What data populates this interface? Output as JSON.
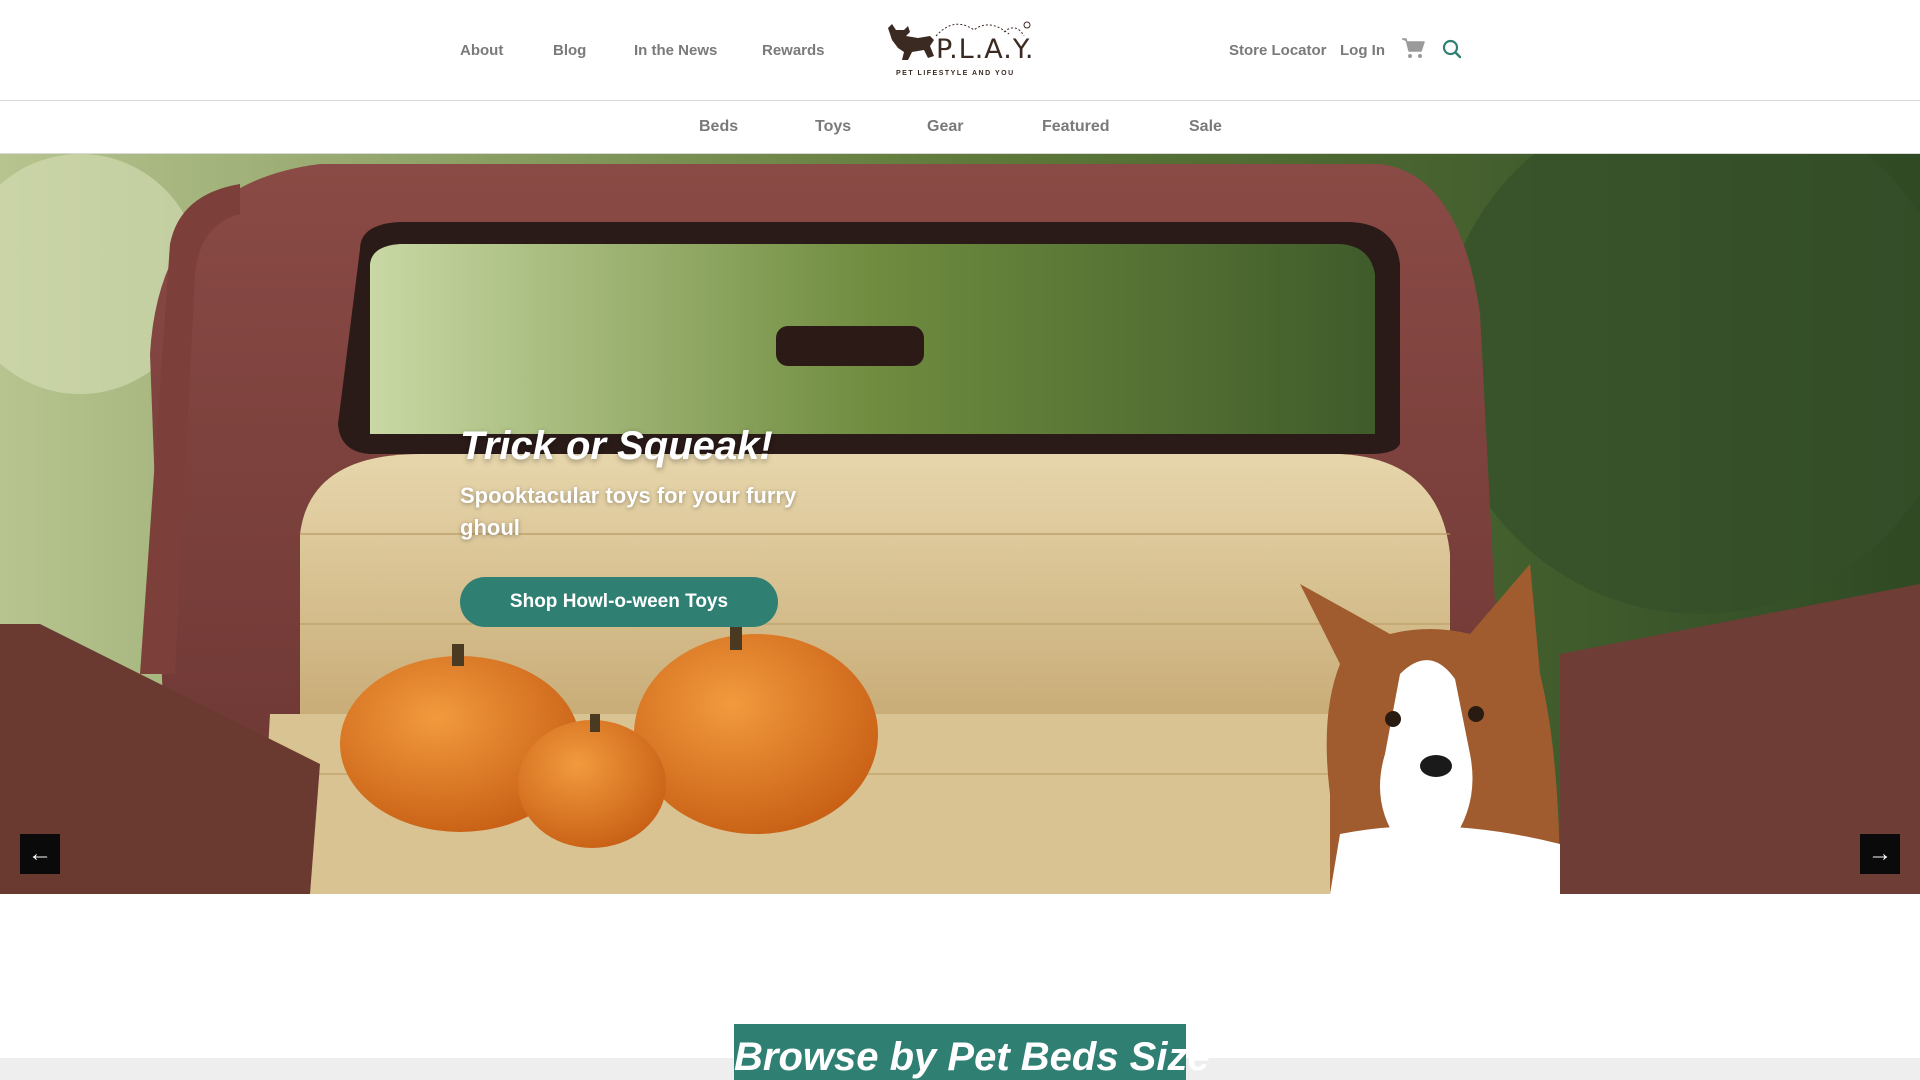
{
  "header": {
    "left_links": [
      "About",
      "Blog",
      "In the News",
      "Rewards"
    ],
    "logo": {
      "name": "P.L.A.Y.",
      "tagline": "PET LIFESTYLE AND YOU",
      "mark": "®"
    },
    "store_locator": "Store Locator",
    "login": "Log In",
    "cart_icon": "cart-icon",
    "search_icon": "search-icon"
  },
  "category_nav": [
    "Beds",
    "Toys",
    "Gear",
    "Featured",
    "Sale"
  ],
  "hero": {
    "title": "Trick or Squeak!",
    "subtitle": "Spooktacular toys for your furry ghoul",
    "cta": "Shop Howl-o-ween Toys",
    "prev_icon": "arrow-left-icon",
    "next_icon": "arrow-right-icon",
    "prev_glyph": "←",
    "next_glyph": "→"
  },
  "browse": {
    "title": "Browse by Pet Beds Size"
  },
  "colors": {
    "accent": "#2f7f73",
    "nav_text": "#7a7a7a",
    "logo_brown": "#3b2a22"
  }
}
